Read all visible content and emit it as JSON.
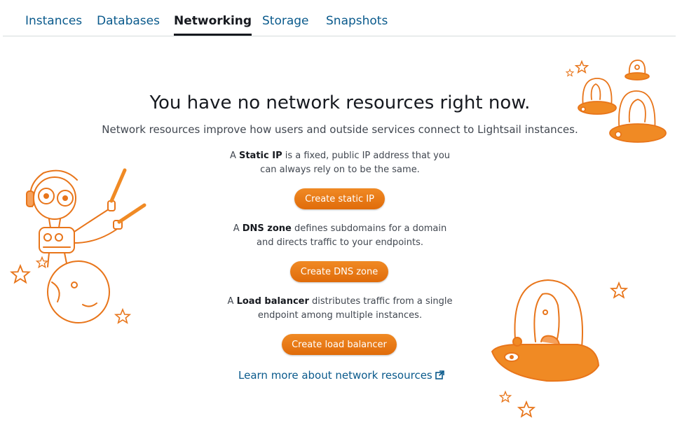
{
  "tabs": [
    {
      "label": "Instances",
      "active": false
    },
    {
      "label": "Databases",
      "active": false
    },
    {
      "label": "Networking",
      "active": true
    },
    {
      "label": "Storage",
      "active": false
    },
    {
      "label": "Snapshots",
      "active": false
    }
  ],
  "empty_state": {
    "headline": "You have no network resources right now.",
    "subtitle": "Network resources improve how users and outside services connect to Lightsail instances.",
    "sections": [
      {
        "prefix": "A ",
        "term": "Static IP",
        "text": " is a fixed, public IP address that you can always rely on to be the same.",
        "button": "Create static IP"
      },
      {
        "prefix": "A ",
        "term": "DNS zone",
        "text": " defines subdomains for a domain and directs traffic to your endpoints.",
        "button": "Create DNS zone"
      },
      {
        "prefix": "A ",
        "term": "Load balancer",
        "text": " distributes traffic from a single endpoint among multiple instances.",
        "button": "Create load balancer"
      }
    ],
    "learn_more": "Learn more about network resources"
  },
  "colors": {
    "accent_orange": "#ec7211",
    "link_blue": "#0a5a8c",
    "text_dark": "#16191f"
  },
  "icons": {
    "external_link": "external-link-icon",
    "robot": "robot-illustration",
    "aliens": "alien-saucer-illustration",
    "stars": "star-icon"
  }
}
